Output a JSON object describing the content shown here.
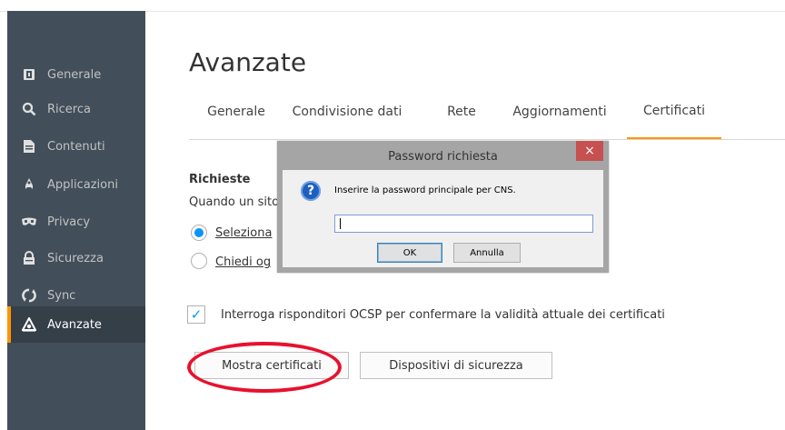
{
  "sidebar": {
    "items": [
      {
        "label": "Generale",
        "icon": "general-icon"
      },
      {
        "label": "Ricerca",
        "icon": "search-icon"
      },
      {
        "label": "Contenuti",
        "icon": "content-icon"
      },
      {
        "label": "Applicazioni",
        "icon": "applications-icon"
      },
      {
        "label": "Privacy",
        "icon": "privacy-mask-icon"
      },
      {
        "label": "Sicurezza",
        "icon": "lock-icon"
      },
      {
        "label": "Sync",
        "icon": "sync-icon"
      },
      {
        "label": "Avanzate",
        "icon": "advanced-icon",
        "active": true
      }
    ]
  },
  "page": {
    "title": "Avanzate"
  },
  "tabs": [
    {
      "label": "Generale"
    },
    {
      "label": "Condivisione dati"
    },
    {
      "label": "Rete"
    },
    {
      "label": "Aggiornamenti"
    },
    {
      "label": "Certificati",
      "active": true
    }
  ],
  "requests": {
    "title": "Richieste",
    "description": "Quando un sito",
    "options": [
      {
        "label": "Seleziona",
        "checked": true
      },
      {
        "label": "Chiedi og",
        "checked": false
      }
    ]
  },
  "ocsp": {
    "checked": true,
    "label": "Interroga risponditori OCSP per confermare la validità attuale dei certificati"
  },
  "buttons": {
    "show_certificates": "Mostra certificati",
    "security_devices": "Dispositivi di sicurezza"
  },
  "dialog": {
    "title": "Password richiesta",
    "close": "×",
    "message": "Inserire la password principale per CNS.",
    "password_value": "",
    "ok": "OK",
    "cancel": "Annulla"
  },
  "colors": {
    "sidebar_bg": "#424f5a",
    "accent": "#ff9500",
    "checkbox_blue": "#0996f8",
    "highlight_red": "#e8112d"
  }
}
